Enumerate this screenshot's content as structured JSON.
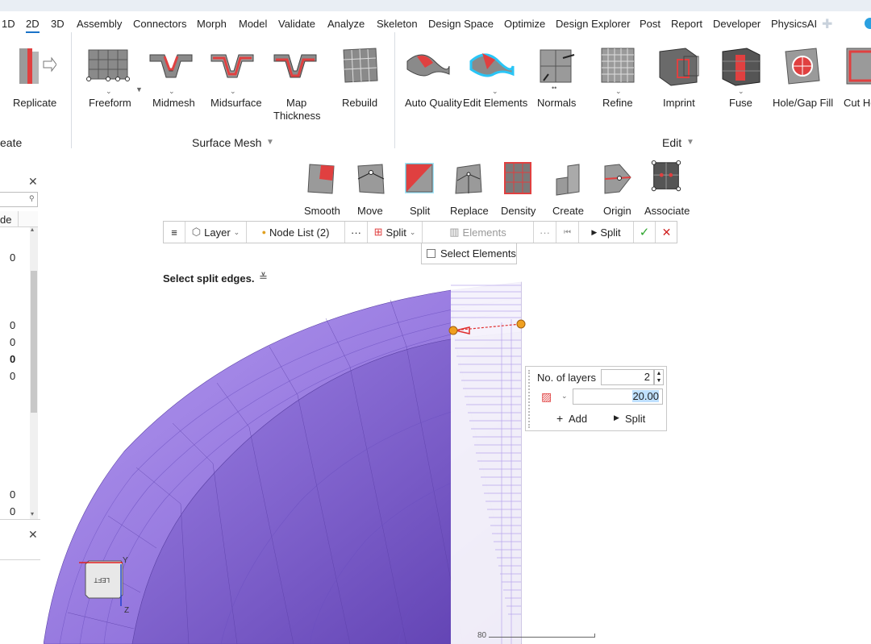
{
  "menu": {
    "items": [
      "1D",
      "2D",
      "3D",
      "Assembly",
      "Connectors",
      "Morph",
      "Model",
      "Validate",
      "Analyze",
      "Skeleton",
      "Design Space",
      "Optimize",
      "Design Explorer",
      "Post",
      "Report",
      "Developer",
      "PhysicsAI"
    ],
    "active": "2D"
  },
  "ribbon": {
    "create_tools": [
      {
        "label": "Replicate"
      }
    ],
    "surface_mesh_tools": [
      {
        "label": "Freeform"
      },
      {
        "label": "Midmesh"
      },
      {
        "label": "Midsurface"
      },
      {
        "label": "Map Thickness",
        "line1": "Map",
        "line2": "Thickness"
      },
      {
        "label": "Rebuild"
      }
    ],
    "edit_tools": [
      {
        "label": "Auto Quality"
      },
      {
        "label": "Edit Elements"
      },
      {
        "label": "Normals"
      },
      {
        "label": "Refine"
      },
      {
        "label": "Imprint"
      },
      {
        "label": "Fuse"
      },
      {
        "label": "Hole/Gap Fill"
      },
      {
        "label": "Cut Ho"
      }
    ],
    "groups": {
      "create": "eate",
      "surface_mesh": "Surface Mesh",
      "edit": "Edit"
    }
  },
  "secondary_tools": [
    "Smooth",
    "Move",
    "Split",
    "Replace",
    "Density",
    "Create",
    "Origin",
    "Associate"
  ],
  "toolbar": {
    "menu_icon": "hamburger-icon",
    "layer": "Layer",
    "node_list": "Node List (2)",
    "more1": "···",
    "split_mode": "Split",
    "elements": "Elements",
    "more2": "···",
    "reset_icon": "reset-icon",
    "split_run": "Split",
    "confirm_icon": "check-icon",
    "cancel_icon": "close-icon"
  },
  "select_elements_popup": {
    "label": "Select Elements",
    "checked": false
  },
  "prompt": {
    "text": "Select split edges."
  },
  "layers_popup": {
    "layers_label": "No. of layers",
    "layers_value": "2",
    "ratio_value": "20.00",
    "add_label": "Add",
    "split_label": "Split"
  },
  "left_panel": {
    "search_placeholder": "",
    "column_header": "de",
    "values": [
      "0",
      "0",
      "0",
      "0",
      "0",
      "0",
      "0"
    ]
  },
  "viewcube": {
    "face": "LEFT",
    "axis_z": "Z",
    "axis_y": "Y"
  },
  "scale": {
    "label": "80"
  },
  "colors": {
    "mesh": "#8d6fd6",
    "mesh_dark": "#6f52bf",
    "accent": "#1a73c8",
    "highlight": "#29c5f6"
  }
}
